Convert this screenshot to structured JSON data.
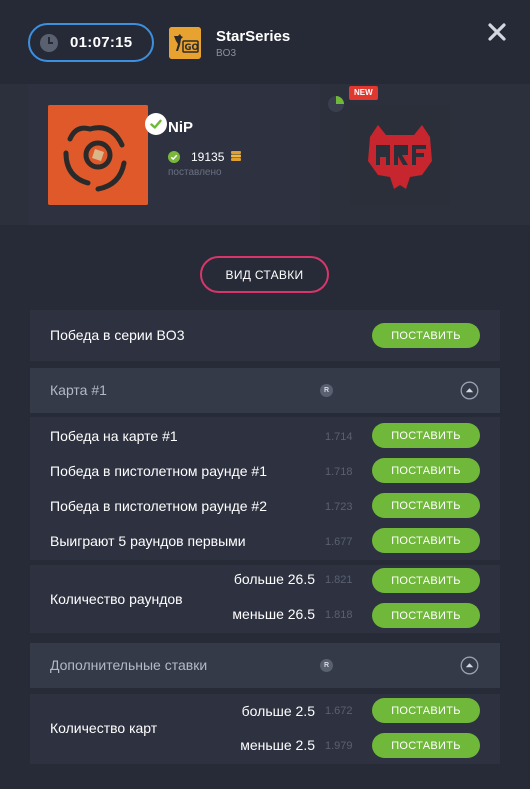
{
  "header": {
    "timer": "01:07:15",
    "tournament": "StarSeries",
    "format": "BO3",
    "game_icon": "csgo-logo",
    "close_icon": "close-icon"
  },
  "teams": {
    "team1": {
      "name": "NiP",
      "bet_amount": "19135",
      "bet_label": "поставлено",
      "selected": true,
      "logo": "nip-logo"
    },
    "team2": {
      "logo": "hellraisers-logo"
    },
    "new_badge": "NEW"
  },
  "bet_type_button": "ВИД СТАВКИ",
  "series_bet": {
    "label": "Победа в серии BO3",
    "button": "ПОСТАВИТЬ"
  },
  "map1": {
    "title": "Карта #1",
    "r_badge": "R",
    "rows": [
      {
        "label": "Победа на карте #1",
        "odds": "1.714",
        "button": "ПОСТАВИТЬ"
      },
      {
        "label": "Победа в пистолетном раунде #1",
        "odds": "1.718",
        "button": "ПОСТАВИТЬ"
      },
      {
        "label": "Победа в пистолетном раунде #2",
        "odds": "1.723",
        "button": "ПОСТАВИТЬ"
      },
      {
        "label": "Выиграют 5 раундов первыми",
        "odds": "1.677",
        "button": "ПОСТАВИТЬ"
      }
    ],
    "rounds": {
      "label": "Количество раундов",
      "options": [
        {
          "label": "больше 26.5",
          "odds": "1.821",
          "button": "ПОСТАВИТЬ"
        },
        {
          "label": "меньше 26.5",
          "odds": "1.818",
          "button": "ПОСТАВИТЬ"
        }
      ]
    }
  },
  "extra": {
    "title": "Дополнительные ставки",
    "r_badge": "R",
    "maps": {
      "label": "Количество карт",
      "options": [
        {
          "label": "больше 2.5",
          "odds": "1.672",
          "button": "ПОСТАВИТЬ"
        },
        {
          "label": "меньше 2.5",
          "odds": "1.979",
          "button": "ПОСТАВИТЬ"
        }
      ]
    }
  },
  "colors": {
    "accent_blue": "#3d8fe0",
    "accent_pink": "#d8366a",
    "button_green": "#6fb83a",
    "background": "#272b37"
  }
}
